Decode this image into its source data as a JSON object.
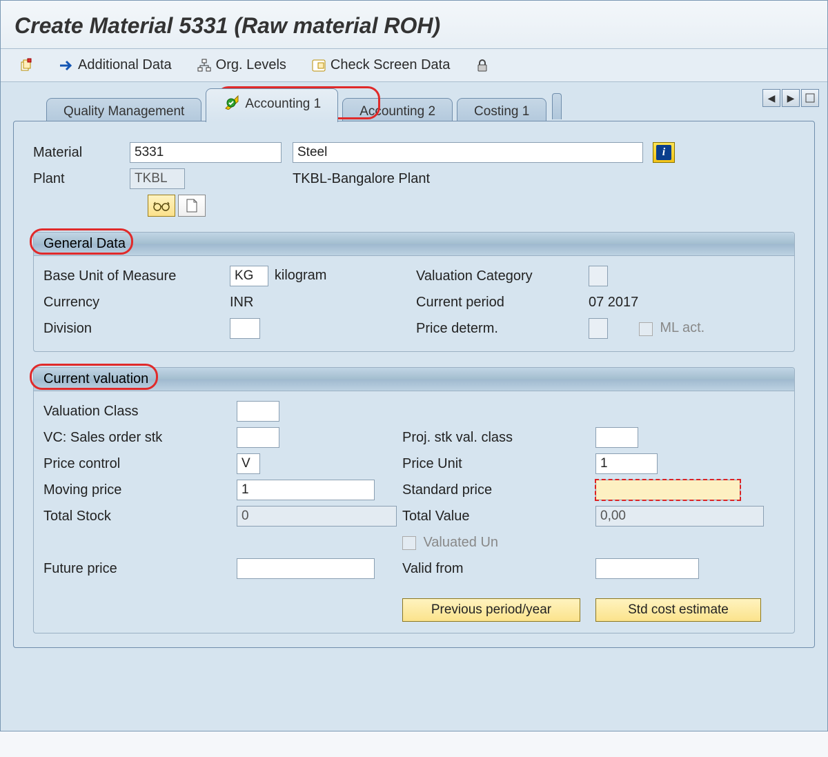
{
  "title": "Create Material 5331 (Raw material ROH)",
  "toolbar": {
    "additional_data": "Additional Data",
    "org_levels": "Org. Levels",
    "check_screen": "Check Screen Data"
  },
  "tabs": {
    "t1": "Quality Management",
    "t2": "Accounting 1",
    "t3": "Accounting 2",
    "t4": "Costing 1"
  },
  "header": {
    "material_label": "Material",
    "material_value": "5331",
    "material_desc": "Steel",
    "plant_label": "Plant",
    "plant_value": "TKBL",
    "plant_desc": "TKBL-Bangalore Plant"
  },
  "general": {
    "title": "General Data",
    "base_uom_label": "Base Unit of Measure",
    "base_uom": "KG",
    "base_uom_text": "kilogram",
    "val_cat_label": "Valuation Category",
    "currency_label": "Currency",
    "currency": "INR",
    "curr_period_label": "Current period",
    "curr_period": "07 2017",
    "division_label": "Division",
    "price_determ_label": "Price determ.",
    "ml_act_label": "ML act."
  },
  "valuation": {
    "title": "Current valuation",
    "val_class_label": "Valuation Class",
    "vc_sales_label": "VC: Sales order stk",
    "proj_stk_label": "Proj. stk val. class",
    "price_ctrl_label": "Price control",
    "price_ctrl": "V",
    "price_unit_label": "Price Unit",
    "price_unit": "1",
    "moving_price_label": "Moving price",
    "moving_price": "1",
    "std_price_label": "Standard price",
    "total_stock_label": "Total Stock",
    "total_stock": "0",
    "total_value_label": "Total Value",
    "total_value": "0,00",
    "valuated_un_label": "Valuated Un",
    "future_price_label": "Future price",
    "valid_from_label": "Valid from",
    "prev_period_btn": "Previous period/year",
    "std_cost_btn": "Std cost estimate"
  }
}
